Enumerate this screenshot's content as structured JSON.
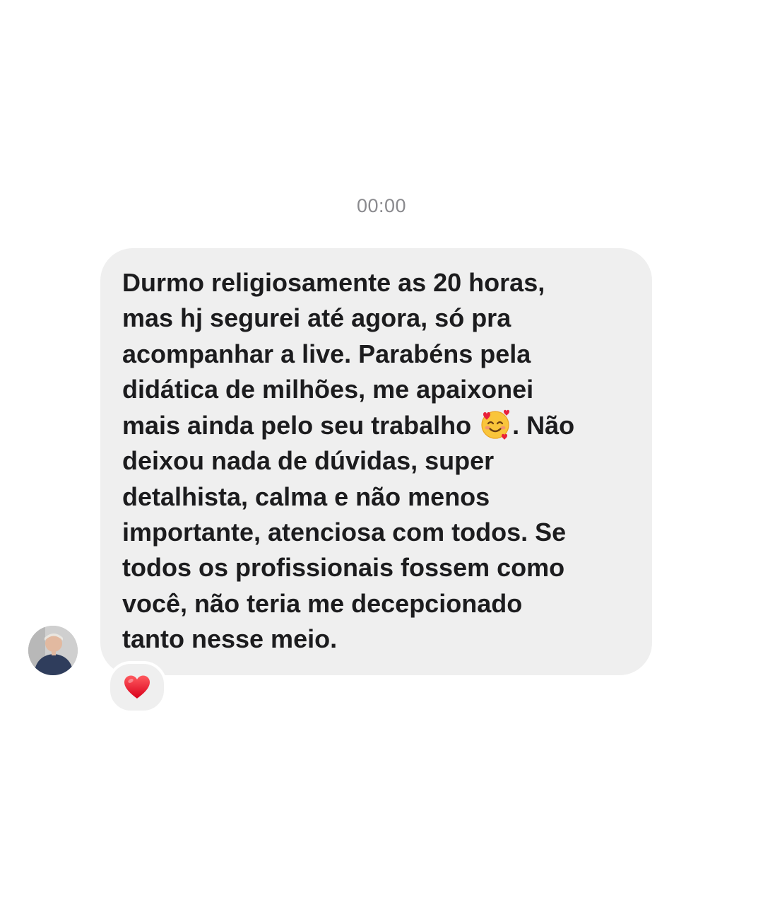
{
  "thread": {
    "timestamp": "00:00"
  },
  "message": {
    "text_before_emoji": "Durmo religiosamente as 20 horas,\nmas hj segurei até agora, só pra\nacompanhar a live. Parabéns pela\ndidática de milhões, me apaixonei\nmais ainda pelo seu trabalho ",
    "emoji": "smiling-face-with-hearts-icon",
    "text_after_emoji": ". Não\ndeixou nada de dúvidas, super\ndetalhista, calma e não menos\nimportante, atenciosa com todos. Se\ntodos os profissionais fossem como\nvocê, não teria me decepcionado\ntanto nesse meio.",
    "reaction": "red-heart-icon",
    "bubble_color": "#efefef",
    "text_color": "#1c1c1e"
  },
  "sender": {
    "avatar": "user-avatar"
  }
}
